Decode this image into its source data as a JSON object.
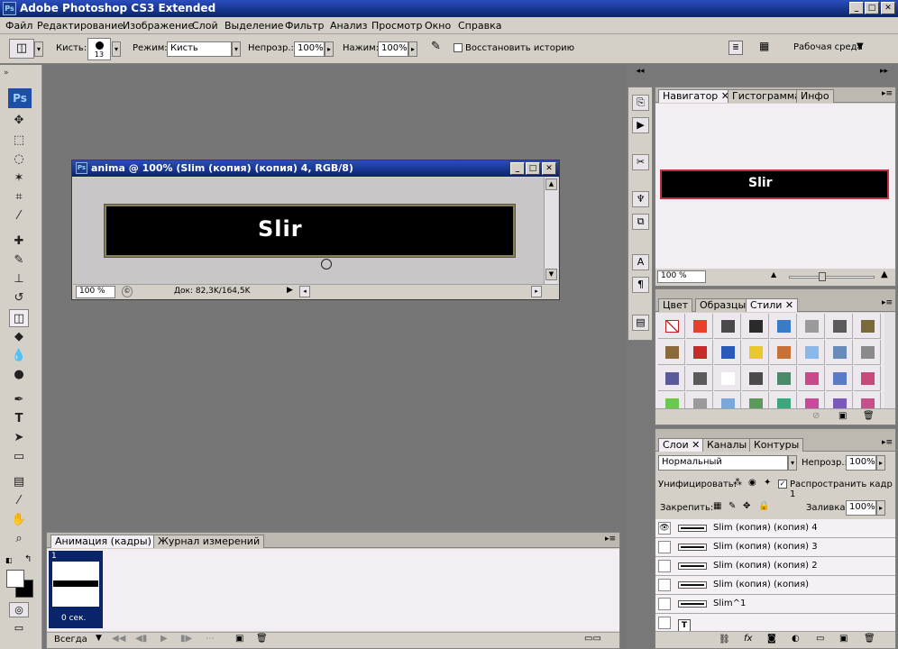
{
  "app": {
    "title": "Adobe Photoshop CS3 Extended",
    "logo": "Ps"
  },
  "menu": [
    "Файл",
    "Редактирование",
    "Изображение",
    "Слой",
    "Выделение",
    "Фильтр",
    "Анализ",
    "Просмотр",
    "Окно",
    "Справка"
  ],
  "options": {
    "brush_label": "Кисть:",
    "brush_size": "13",
    "mode_label": "Режим:",
    "mode_value": "Кисть",
    "opacity_label": "Непрозр.:",
    "opacity_value": "100%",
    "flow_label": "Нажим:",
    "flow_value": "100%",
    "restore_label": "Восстановить историю",
    "workspace_label": "Рабочая среда"
  },
  "document": {
    "title": "anima @ 100% (Slim (копия) (копия) 4, RGB/8)",
    "canvas_text": "Slir",
    "zoom": "100 %",
    "doc_info": "Док: 82,3K/164,5K"
  },
  "navigator": {
    "tabs": [
      "Навигатор",
      "Гистограмма",
      "Инфо"
    ],
    "preview_text": "Slir",
    "zoom": "100 %"
  },
  "styles_panel": {
    "tabs": [
      "Цвет",
      "Образцы",
      "Стили"
    ]
  },
  "layers_panel": {
    "tabs": [
      "Слои",
      "Каналы",
      "Контуры"
    ],
    "blend_mode": "Нормальный",
    "opacity_label": "Непрозр.:",
    "opacity_value": "100%",
    "unify_label": "Унифицировать:",
    "propagate_label": "Распространить кадр 1",
    "lock_label": "Закрепить:",
    "fill_label": "Заливка:",
    "fill_value": "100%",
    "layers": [
      {
        "name": "Slim (копия) (копия) 4",
        "selected": true,
        "visible": true
      },
      {
        "name": "Slim (копия) (копия) 3",
        "selected": false,
        "visible": false
      },
      {
        "name": "Slim (копия) (копия) 2",
        "selected": false,
        "visible": false
      },
      {
        "name": "Slim (копия) (копия)",
        "selected": false,
        "visible": false
      },
      {
        "name": "Slim^1",
        "selected": false,
        "visible": false
      }
    ]
  },
  "animation_panel": {
    "tabs": [
      "Анимация (кадры)",
      "Журнал измерений"
    ],
    "frame_number": "1",
    "frame_delay": "0 сек.",
    "loop": "Всегда"
  }
}
